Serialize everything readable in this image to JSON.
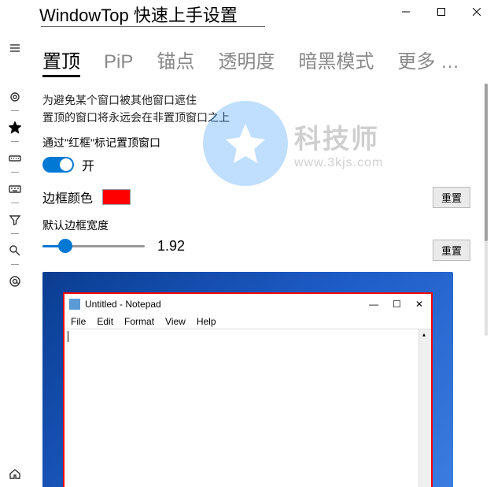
{
  "window": {
    "title": "WindowTop 快速上手设置"
  },
  "leftbar": {
    "items": [
      "menu",
      "gear",
      "star",
      "keyboard",
      "keyboard2",
      "filter",
      "search-tilt",
      "at",
      "home"
    ]
  },
  "tabs": {
    "items": [
      {
        "label": "置顶",
        "active": true
      },
      {
        "label": "PiP"
      },
      {
        "label": "锚点"
      },
      {
        "label": "透明度"
      },
      {
        "label": "暗黑模式"
      },
      {
        "label": "更多 …"
      }
    ]
  },
  "content": {
    "desc_line1": "为避免某个窗口被其他窗口遮住",
    "desc_line2": "置顶的窗口将永远会在非置顶窗口之上",
    "mark_label": "通过\"红框\"标记置顶窗口",
    "toggle_state": "开",
    "border_color_label": "边框颜色",
    "border_color": "#ff0000",
    "reset_label": "重置",
    "border_width_label": "默认边框宽度",
    "border_width_value": "1.92"
  },
  "notepad": {
    "title": "Untitled - Notepad",
    "menu": [
      "File",
      "Edit",
      "Format",
      "View",
      "Help"
    ]
  },
  "watermark": {
    "name": "科技师",
    "url": "www.3kjs.com"
  }
}
